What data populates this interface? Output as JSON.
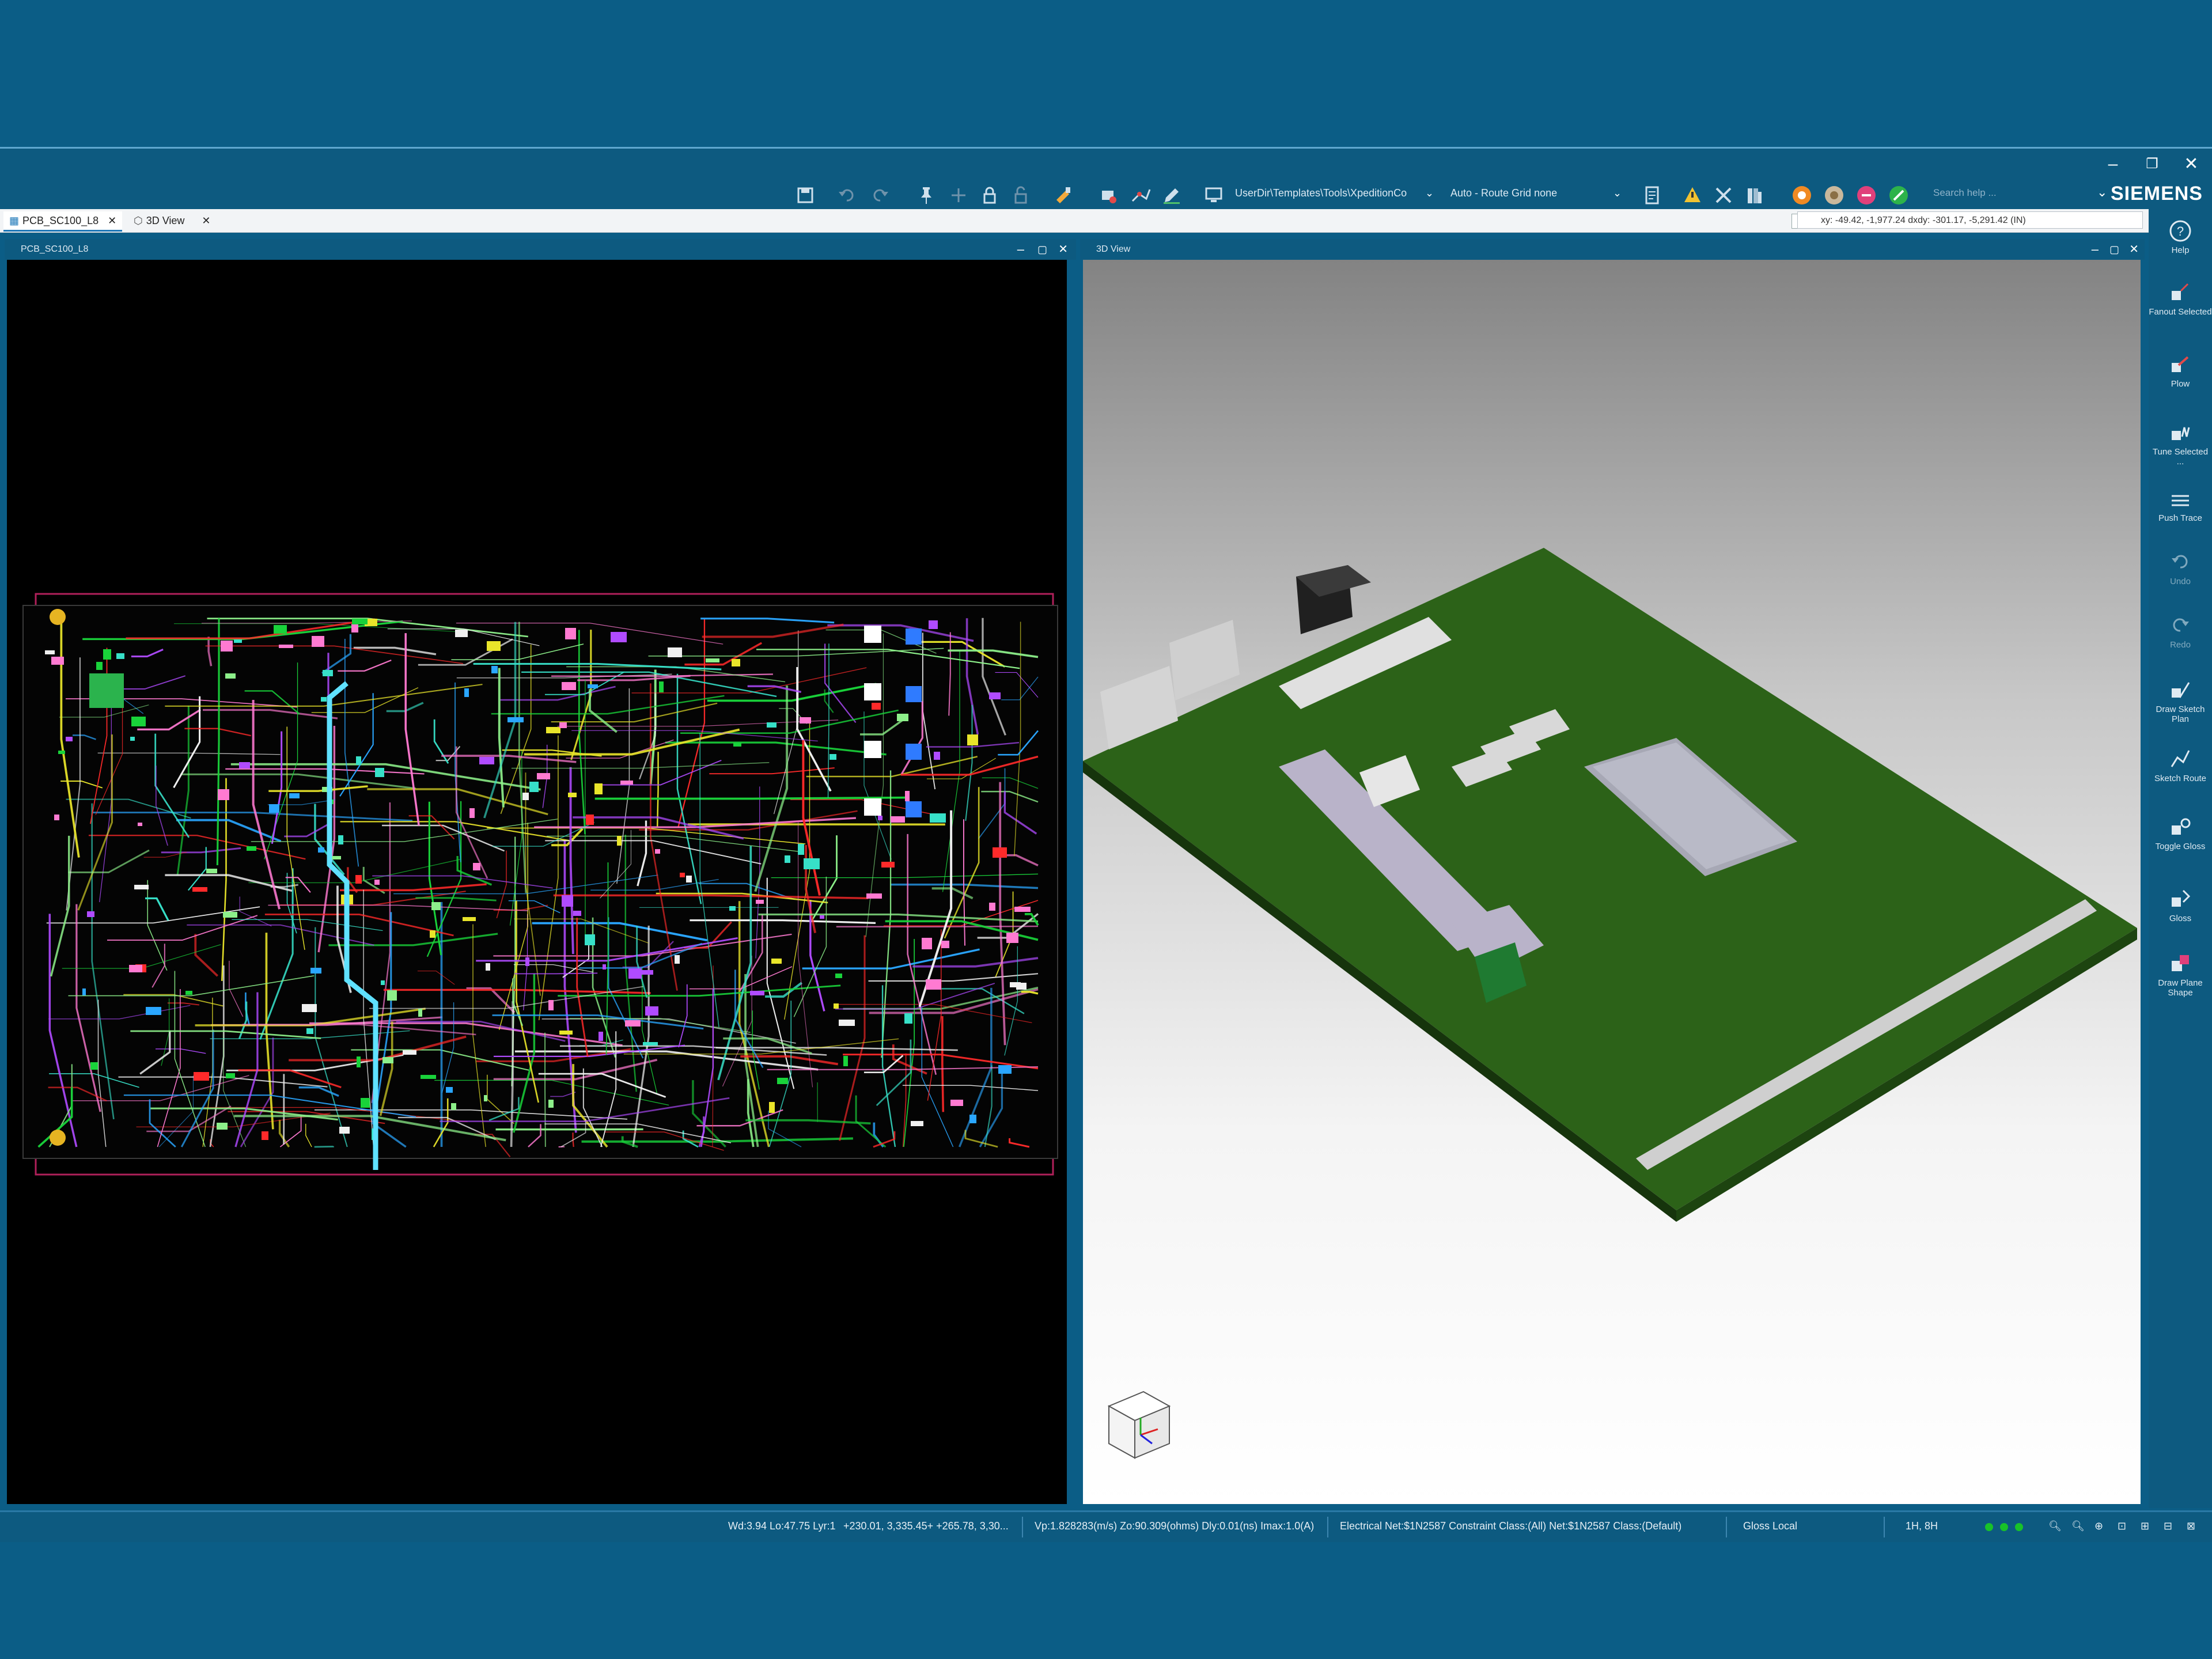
{
  "toolbar": {
    "path_select": "UserDir\\Templates\\Tools\\XpeditionCo",
    "route_grid": "Auto - Route Grid none",
    "search_placeholder": "Search help ...",
    "brand": "SIEMENS"
  },
  "tabs": [
    {
      "label": "PCB_SC100_L8"
    },
    {
      "label": "3D View"
    }
  ],
  "coord_readout": "xy: -49.42, -1,977.24  dxdy: -301.17, -5,291.42  (IN)",
  "panes": {
    "pcb": {
      "title": "PCB_SC100_L8"
    },
    "view3d": {
      "title": "3D View"
    }
  },
  "right_tools": [
    {
      "label": "Help",
      "icon": "help-icon"
    },
    {
      "label": "Fanout Selected",
      "icon": "fanout-icon"
    },
    {
      "label": "Plow",
      "icon": "plow-icon"
    },
    {
      "label": "Tune Selected ...",
      "icon": "tune-icon"
    },
    {
      "label": "Push Trace",
      "icon": "push-trace-icon"
    },
    {
      "label": "Undo",
      "icon": "undo-icon"
    },
    {
      "label": "Redo",
      "icon": "redo-icon"
    },
    {
      "label": "Draw Sketch Plan",
      "icon": "sketch-plan-icon"
    },
    {
      "label": "Sketch Route",
      "icon": "sketch-route-icon"
    },
    {
      "label": "Toggle Gloss",
      "icon": "toggle-gloss-icon"
    },
    {
      "label": "Gloss",
      "icon": "gloss-icon"
    },
    {
      "label": "Draw Plane Shape",
      "icon": "plane-shape-icon"
    }
  ],
  "status": {
    "s1": "Wd:3.94 Lo:47.75 Lyr:1",
    "s2": "+230.01, 3,335.45+ +265.78, 3,30...",
    "s3": "Vp:1.828283(m/s) Zo:90.309(ohms) Dly:0.01(ns) Imax:1.0(A)",
    "s4": "Electrical Net:$1N2587 Constraint Class:(All) Net:$1N2587 Class:(Default)",
    "s5": "Gloss Local",
    "s6": "1H, 8H"
  },
  "colors": {
    "accent": "#0d5a80",
    "board_green": "#2c6218",
    "status_ok": "#18c229"
  }
}
